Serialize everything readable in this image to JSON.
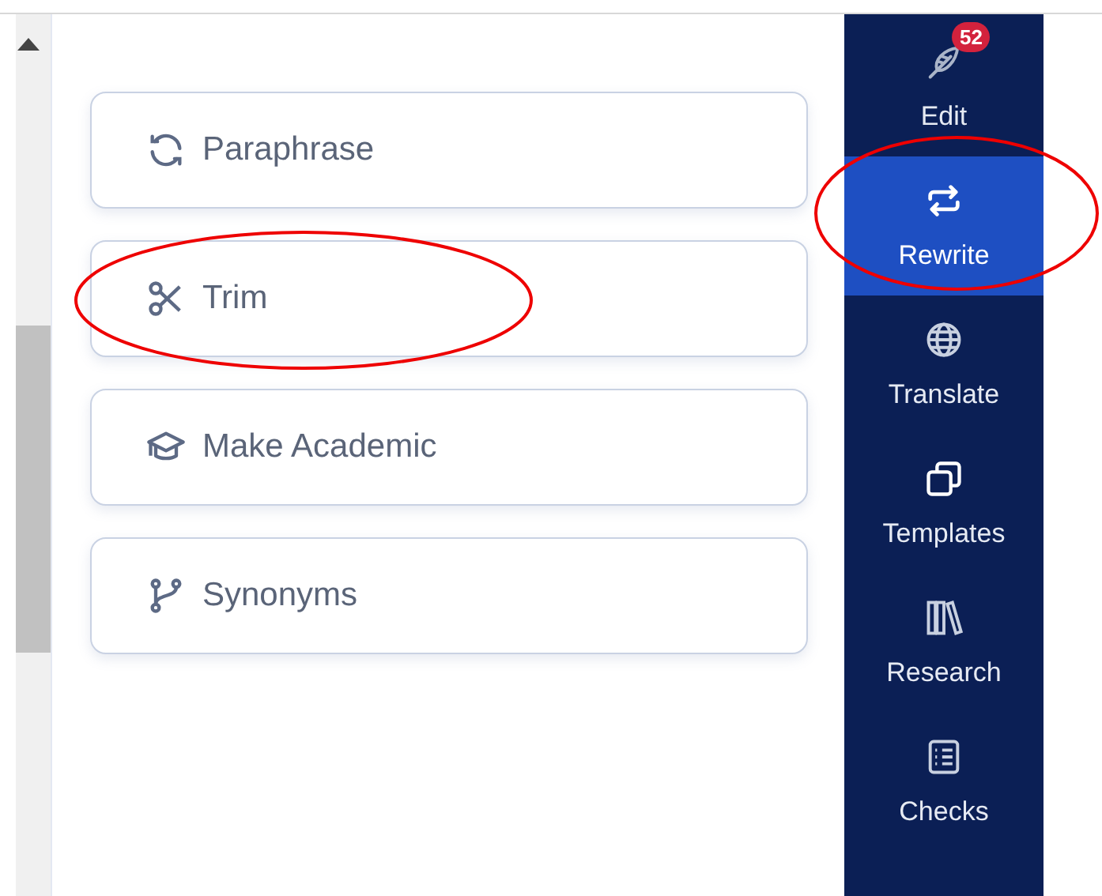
{
  "options": [
    {
      "label": "Paraphrase",
      "kind": "cycle",
      "annotated": false
    },
    {
      "label": "Trim",
      "kind": "scissors",
      "annotated": true
    },
    {
      "label": "Make Academic",
      "kind": "cap",
      "annotated": false
    },
    {
      "label": "Synonyms",
      "kind": "branch",
      "annotated": false
    }
  ],
  "nav": [
    {
      "label": "Edit",
      "kind": "quill",
      "badge": "52",
      "selected": false,
      "annotated": false
    },
    {
      "label": "Rewrite",
      "kind": "swap",
      "selected": true,
      "annotated": true
    },
    {
      "label": "Translate",
      "kind": "globe",
      "selected": false,
      "annotated": false
    },
    {
      "label": "Templates",
      "kind": "windows",
      "selected": false,
      "annotated": false
    },
    {
      "label": "Research",
      "kind": "books",
      "selected": false,
      "annotated": false
    },
    {
      "label": "Checks",
      "kind": "checklist",
      "selected": false,
      "annotated": false
    }
  ]
}
